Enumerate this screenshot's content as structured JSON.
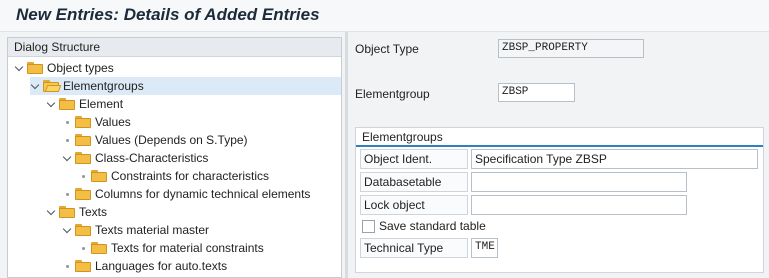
{
  "window": {
    "title": "New Entries: Details of Added Entries"
  },
  "dialog_structure": {
    "header": "Dialog Structure",
    "nodes": [
      {
        "label": "Object types",
        "level": 0,
        "expander": "open",
        "folder": "closed",
        "selected": false
      },
      {
        "label": "Elementgroups",
        "level": 1,
        "expander": "open",
        "folder": "open",
        "selected": true
      },
      {
        "label": "Element",
        "level": 2,
        "expander": "open",
        "folder": "closed",
        "selected": false
      },
      {
        "label": "Values",
        "level": 3,
        "expander": "leaf",
        "folder": "closed",
        "selected": false
      },
      {
        "label": "Values (Depends on S.Type)",
        "level": 3,
        "expander": "leaf",
        "folder": "closed",
        "selected": false
      },
      {
        "label": "Class-Characteristics",
        "level": 3,
        "expander": "open",
        "folder": "closed",
        "selected": false
      },
      {
        "label": "Constraints for characteristics",
        "level": 4,
        "expander": "leaf",
        "folder": "closed",
        "selected": false
      },
      {
        "label": "Columns for dynamic technical elements",
        "level": 3,
        "expander": "leaf",
        "folder": "closed",
        "selected": false
      },
      {
        "label": "Texts",
        "level": 2,
        "expander": "open",
        "folder": "closed",
        "selected": false
      },
      {
        "label": "Texts material master",
        "level": 3,
        "expander": "open",
        "folder": "closed",
        "selected": false
      },
      {
        "label": "Texts  for material constraints",
        "level": 4,
        "expander": "leaf",
        "folder": "closed",
        "selected": false
      },
      {
        "label": "Languages for auto.texts",
        "level": 3,
        "expander": "leaf",
        "folder": "closed",
        "selected": false
      }
    ]
  },
  "details": {
    "object_type": {
      "label": "Object Type",
      "value": "ZBSP_PROPERTY"
    },
    "elementgroup": {
      "label": "Elementgroup",
      "value": "ZBSP"
    }
  },
  "elementgroups": {
    "title": "Elementgroups",
    "object_ident": {
      "label": "Object Ident.",
      "value": "Specification Type ZBSP"
    },
    "databasetable": {
      "label": "Databasetable",
      "value": ""
    },
    "lock_object": {
      "label": "Lock object",
      "value": ""
    },
    "save_standard_table": {
      "label": "Save standard table",
      "checked": false
    },
    "technical_type": {
      "label": "Technical Type",
      "value": "TME"
    }
  },
  "colors": {
    "accent": "#2f7fc1",
    "folder": "#f2be45",
    "selected_row": "#dce9f6"
  }
}
